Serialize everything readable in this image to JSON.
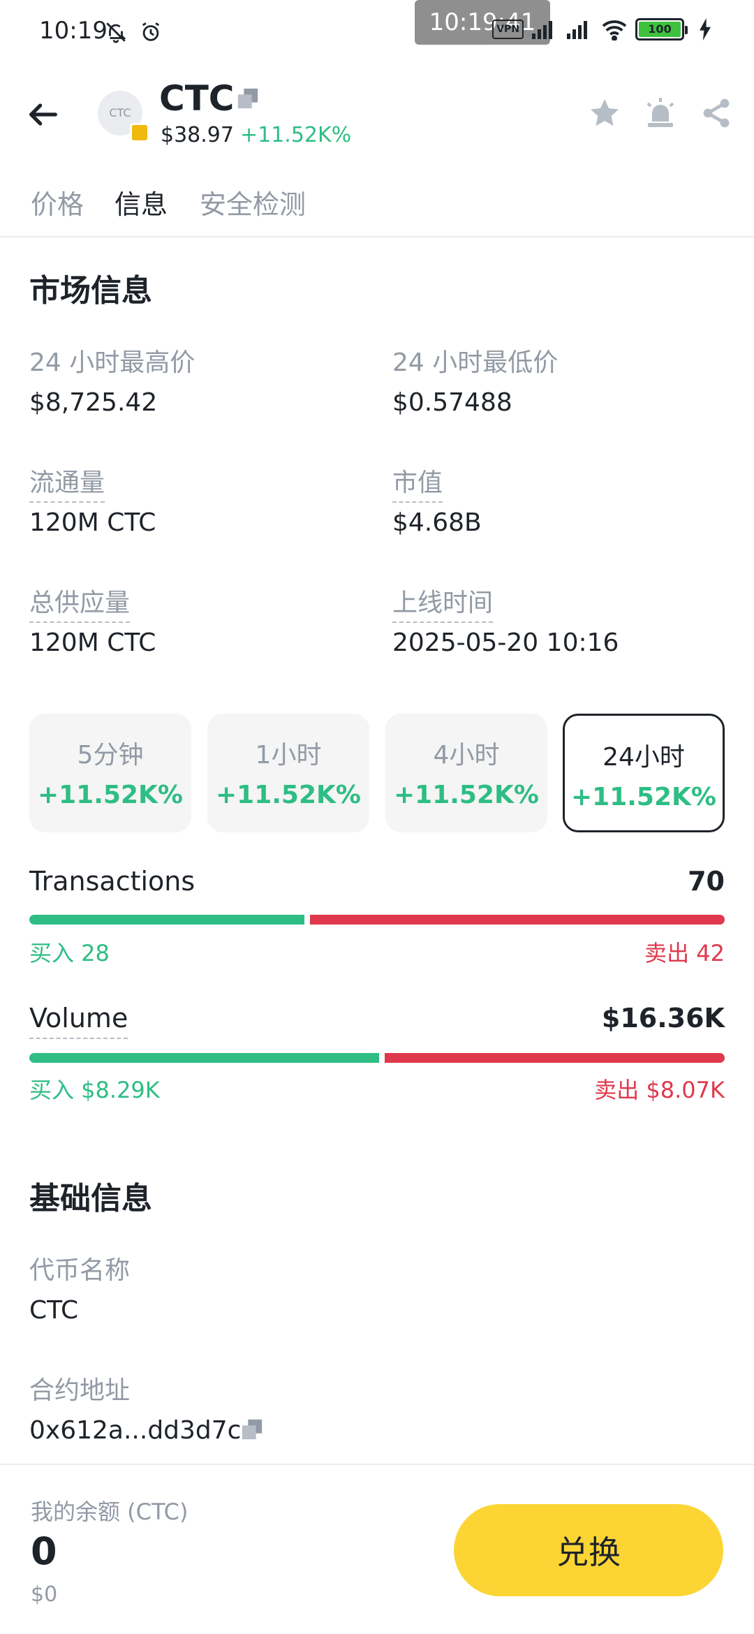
{
  "status_bar": {
    "time": "10:19",
    "overlay_time": "10:19:41",
    "vpn": "VPN",
    "battery": "100"
  },
  "header": {
    "logo_text": "CTC",
    "symbol": "CTC",
    "price": "$38.97",
    "change": "+11.52K%"
  },
  "tabs": [
    "价格",
    "信息",
    "安全检测"
  ],
  "market": {
    "title": "市场信息",
    "high_label": "24 小时最高价",
    "high_value": "$8,725.42",
    "low_label": "24 小时最低价",
    "low_value": "$0.57488",
    "circ_label": "流通量",
    "circ_value": "120M CTC",
    "mcap_label": "市值",
    "mcap_value": "$4.68B",
    "supply_label": "总供应量",
    "supply_value": "120M CTC",
    "listed_label": "上线时间",
    "listed_value": "2025-05-20 10:16"
  },
  "periods": [
    {
      "label": "5分钟",
      "value": "+11.52K%"
    },
    {
      "label": "1小时",
      "value": "+11.52K%"
    },
    {
      "label": "4小时",
      "value": "+11.52K%"
    },
    {
      "label": "24小时",
      "value": "+11.52K%"
    }
  ],
  "selected_period_index": 3,
  "transactions": {
    "title": "Transactions",
    "total": "70",
    "buy_text": "买入 28",
    "sell_text": "卖出 42",
    "buy_fraction": 0.4
  },
  "volume": {
    "title": "Volume",
    "total": "$16.36K",
    "buy_text": "买入 $8.29K",
    "sell_text": "卖出 $8.07K",
    "buy_fraction": 0.507
  },
  "basic": {
    "title": "基础信息",
    "name_label": "代币名称",
    "name_value": "CTC",
    "contract_label": "合约地址",
    "contract_value": "0x612a...dd3d7c"
  },
  "bottom": {
    "balance_label": "我的余额 (CTC)",
    "balance_amount": "0",
    "balance_usd": "$0",
    "swap_label": "兑换"
  },
  "colors": {
    "up": "#2ebd85",
    "down": "#e0384c",
    "accent": "#fcd535"
  }
}
